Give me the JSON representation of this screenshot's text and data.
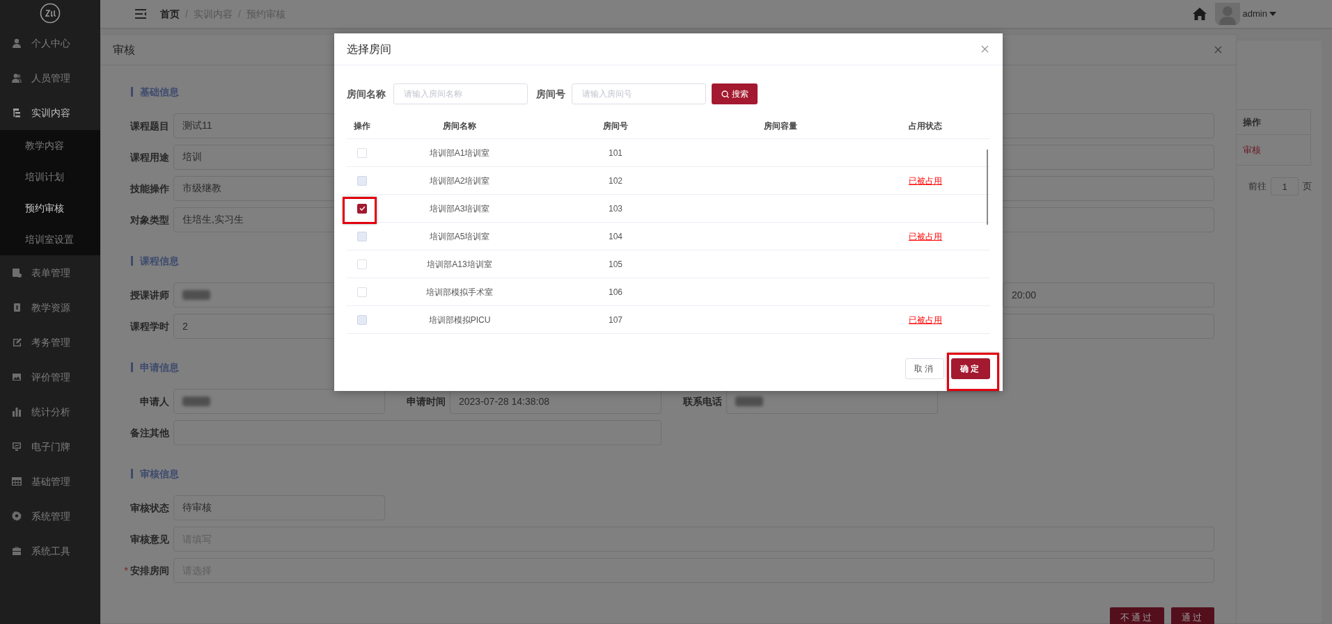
{
  "topbar": {
    "separator": "/",
    "user": "admin",
    "breadcrumb": [
      {
        "label": "首页",
        "link": true
      },
      {
        "label": "实训内容",
        "link": false
      },
      {
        "label": "预约审核",
        "link": false
      }
    ]
  },
  "sidebar": {
    "items": [
      {
        "label": "个人中心",
        "expanded": false
      },
      {
        "label": "人员管理",
        "expanded": false
      },
      {
        "label": "实训内容",
        "expanded": true,
        "children": [
          {
            "label": "教学内容",
            "selected": false
          },
          {
            "label": "培训计划",
            "selected": false
          },
          {
            "label": "预约审核",
            "selected": true
          },
          {
            "label": "培训室设置",
            "selected": false
          }
        ]
      },
      {
        "label": "表单管理",
        "expanded": false
      },
      {
        "label": "教学资源",
        "expanded": false
      },
      {
        "label": "考务管理",
        "expanded": false
      },
      {
        "label": "评价管理",
        "expanded": false
      },
      {
        "label": "统计分析",
        "expanded": false
      },
      {
        "label": "电子门牌",
        "expanded": false
      },
      {
        "label": "基础管理",
        "expanded": false
      },
      {
        "label": "系统管理",
        "expanded": false
      },
      {
        "label": "系统工具",
        "expanded": false
      }
    ]
  },
  "page_table": {
    "columns": [
      "操作"
    ],
    "rows": [
      {
        "action": "审核"
      }
    ],
    "pagination": {
      "prefix": "前往",
      "page": "1",
      "suffix": "页"
    }
  },
  "review_dialog": {
    "title": "审核",
    "required_mark": "*",
    "sections": [
      {
        "title": "基础信息",
        "fields": [
          {
            "label": "课程题目",
            "value": "测试11",
            "blurred": false
          },
          {
            "label": "课程用途",
            "value": "培训",
            "blurred": false
          },
          {
            "label": "技能操作",
            "value": "市级继教",
            "blurred": false
          },
          {
            "label": "对象类型",
            "value": "住培生,实习生",
            "blurred": false
          }
        ]
      },
      {
        "title": "课程信息",
        "fields": [
          {
            "label": "授课讲师",
            "blurred": true
          },
          {
            "value": "20:00",
            "blurred": false
          },
          {
            "label": "课程学时",
            "value": "2",
            "blurred": false
          }
        ]
      },
      {
        "title": "申请信息",
        "fields": [
          {
            "label": "申请人",
            "blurred": true
          },
          {
            "label": "申请时间",
            "value": "2023-07-28 14:38:08",
            "blurred": false
          },
          {
            "label": "联系电话",
            "blurred": true
          },
          {
            "label": "备注其他",
            "blurred": false
          }
        ]
      },
      {
        "title": "审核信息",
        "fields": [
          {
            "label": "审核状态",
            "value": "待审核",
            "blurred": false
          },
          {
            "label": "审核意见",
            "placeholder": "请填写",
            "blurred": false
          },
          {
            "label": "安排房间",
            "placeholder": "请选择",
            "blurred": false,
            "required": true
          }
        ]
      }
    ],
    "buttons": [
      {
        "label": "不通过"
      },
      {
        "label": "通过"
      }
    ]
  },
  "room_dialog": {
    "title": "选择房间",
    "search_button": "搜索",
    "filters": [
      {
        "label": "房间名称",
        "placeholder": "请输入房间名称"
      },
      {
        "label": "房间号",
        "placeholder": "请输入房间号"
      }
    ],
    "columns": [
      "操作",
      "房间名称",
      "房间号",
      "房间容量",
      "占用状态"
    ],
    "rows": [
      {
        "checked": false,
        "disabled": false,
        "name": "培训部A1培训室",
        "number": "101"
      },
      {
        "checked": false,
        "disabled": true,
        "name": "培训部A2培训室",
        "number": "102",
        "status": "已被占用"
      },
      {
        "checked": true,
        "disabled": false,
        "highlighted": true,
        "name": "培训部A3培训室",
        "number": "103"
      },
      {
        "checked": false,
        "disabled": true,
        "name": "培训部A5培训室",
        "number": "104",
        "status": "已被占用"
      },
      {
        "checked": false,
        "disabled": false,
        "name": "培训部A13培训室",
        "number": "105"
      },
      {
        "checked": false,
        "disabled": false,
        "name": "培训部模拟手术室",
        "number": "106"
      },
      {
        "checked": false,
        "disabled": true,
        "name": "培训部模拟PICU",
        "number": "107",
        "status": "已被占用"
      }
    ],
    "buttons": [
      {
        "label": "取消",
        "kind": "plain"
      },
      {
        "label": "确定",
        "kind": "primary",
        "highlighted": true
      }
    ]
  }
}
